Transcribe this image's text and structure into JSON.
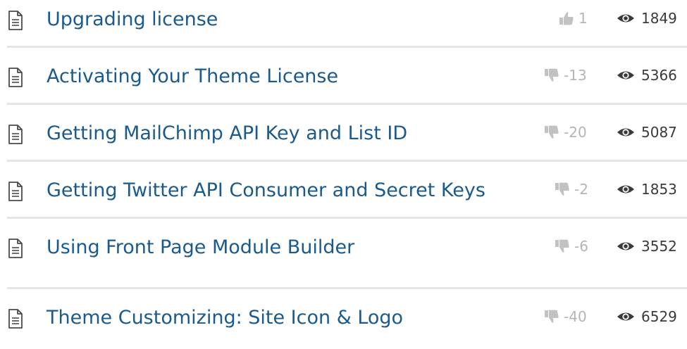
{
  "articles": [
    {
      "title": "Upgrading license",
      "vote_type": "up",
      "votes": "1",
      "views": "1849"
    },
    {
      "title": "Activating Your Theme License",
      "vote_type": "down",
      "votes": "-13",
      "views": "5366"
    },
    {
      "title": "Getting MailChimp API Key and List ID",
      "vote_type": "down",
      "votes": "-20",
      "views": "5087"
    },
    {
      "title": "Getting Twitter API Consumer and Secret Keys",
      "vote_type": "down",
      "votes": "-2",
      "views": "1853"
    },
    {
      "title": "Using Front Page Module Builder",
      "vote_type": "down",
      "votes": "-6",
      "views": "3552"
    },
    {
      "title": "Theme Customizing: Site Icon & Logo",
      "vote_type": "down",
      "votes": "-40",
      "views": "6529"
    }
  ],
  "icons": {
    "article": "document-icon",
    "vote_up": "thumbs-up-icon",
    "vote_down": "thumbs-down-icon",
    "views": "eye-icon"
  },
  "colors": {
    "title": "#1a5a8c",
    "votes": "#b5b5b5",
    "views": "#3a3a3a",
    "divider": "#e6e6e6"
  }
}
